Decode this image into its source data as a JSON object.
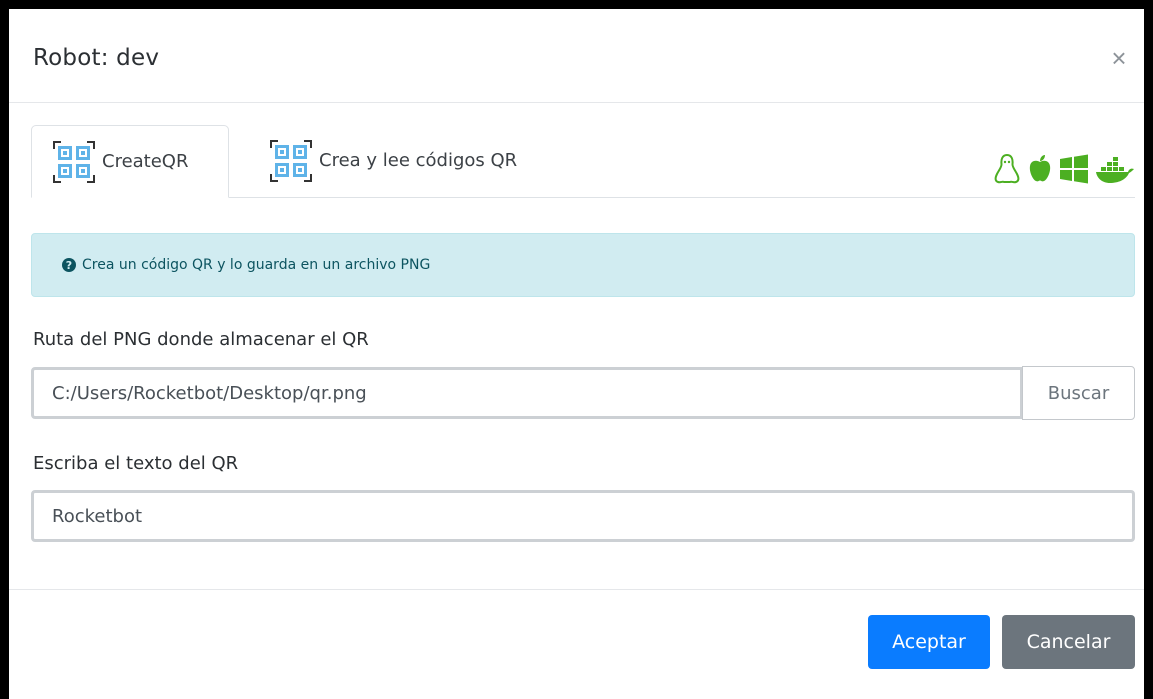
{
  "modal": {
    "title": "Robot: dev",
    "close_symbol": "×"
  },
  "tabs": [
    {
      "label": "CreateQR",
      "icon": "qr-code-icon",
      "active": true
    },
    {
      "label": "Crea y lee códigos QR",
      "icon": "qr-code-icon",
      "active": false
    }
  ],
  "os_icons": [
    "linux-icon",
    "apple-icon",
    "windows-icon",
    "docker-icon"
  ],
  "colors": {
    "os_green": "#4caf22",
    "primary": "#0a7cff",
    "secondary": "#6c757d",
    "alert_bg": "#d1ecf1"
  },
  "info": {
    "icon": "question-circle-icon",
    "text": "Crea un código QR y lo guarda en un archivo PNG"
  },
  "form": {
    "path_label": "Ruta del PNG donde almacenar el QR",
    "path_value": "C:/Users/Rocketbot/Desktop/qr.png",
    "browse_label": "Buscar",
    "text_label": "Escriba el texto del QR",
    "text_value": "Rocketbot"
  },
  "footer": {
    "accept_label": "Aceptar",
    "cancel_label": "Cancelar"
  }
}
